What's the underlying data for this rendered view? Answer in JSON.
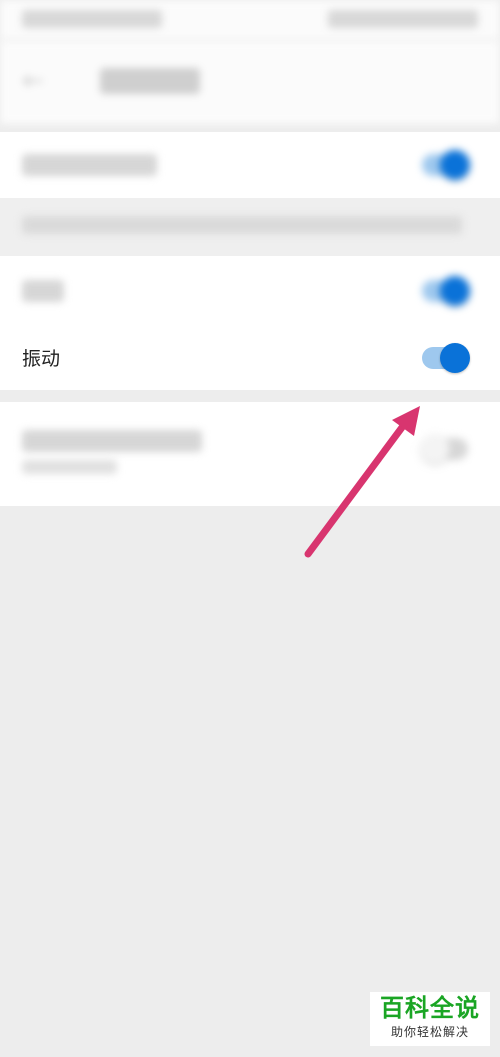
{
  "settings": {
    "vibration": {
      "label": "振动",
      "enabled": true
    }
  },
  "watermark": {
    "title": "百科全说",
    "subtitle": "助你轻松解决"
  },
  "colors": {
    "toggle_on": "#0a72d8",
    "toggle_track_on": "#9ec8ee",
    "arrow": "#d8356f",
    "watermark_green": "#1aa524"
  }
}
